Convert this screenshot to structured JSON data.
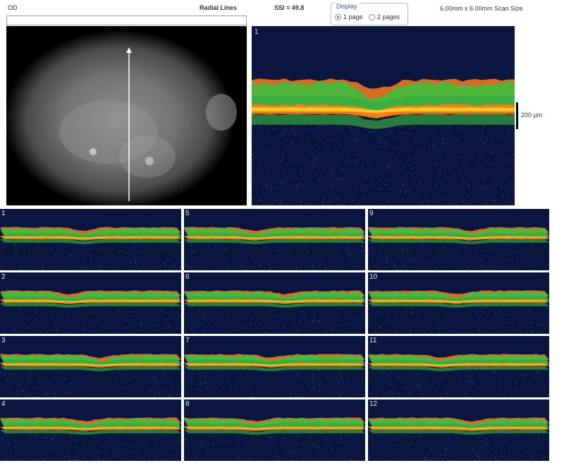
{
  "header": {
    "eye": "OD",
    "scan_type": "Radial Lines",
    "ssi": "SSI = 49.8",
    "scan_size": "6.00mm x 6.00mm Scan Size"
  },
  "display": {
    "title": "Display",
    "options": [
      {
        "label": "1 page",
        "selected": true
      },
      {
        "label": "2 pages",
        "selected": false
      }
    ]
  },
  "main_scan": {
    "number": "1",
    "scale_label": "200 µm"
  },
  "thumbnails": [
    "1",
    "2",
    "3",
    "4",
    "5",
    "6",
    "7",
    "8",
    "9",
    "10",
    "11",
    "12"
  ],
  "colors": {
    "background": "#0a1640",
    "retina": "#3fbf3f",
    "rpe": "#ff7a1a",
    "highlight": "#ffe21a"
  }
}
